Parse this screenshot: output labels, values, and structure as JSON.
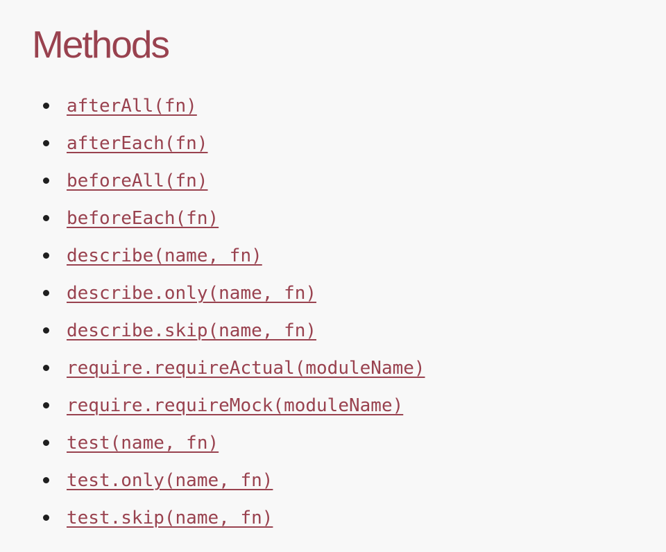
{
  "page": {
    "title": "Methods"
  },
  "methods": [
    {
      "label": "afterAll(fn)"
    },
    {
      "label": "afterEach(fn)"
    },
    {
      "label": "beforeAll(fn)"
    },
    {
      "label": "beforeEach(fn)"
    },
    {
      "label": "describe(name, fn)"
    },
    {
      "label": "describe.only(name, fn)"
    },
    {
      "label": "describe.skip(name, fn)"
    },
    {
      "label": "require.requireActual(moduleName)"
    },
    {
      "label": "require.requireMock(moduleName)"
    },
    {
      "label": "test(name, fn)"
    },
    {
      "label": "test.only(name, fn)"
    },
    {
      "label": "test.skip(name, fn)"
    }
  ],
  "colors": {
    "accent": "#99424f",
    "background": "#f8f8f8",
    "bullet": "#1f1f1f"
  }
}
